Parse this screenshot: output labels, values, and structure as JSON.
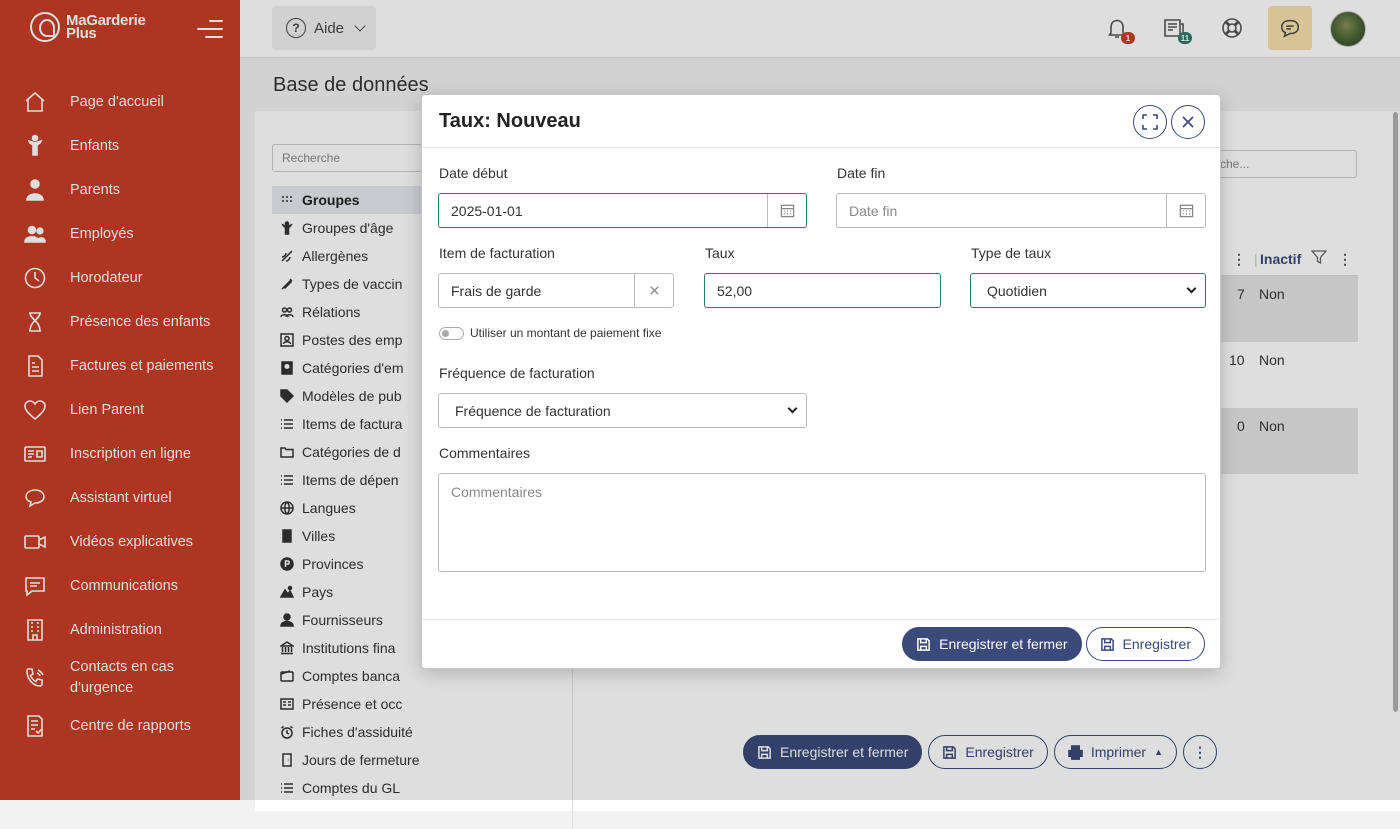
{
  "app": {
    "logo_line1": "MaGarderie",
    "logo_line2": "Plus"
  },
  "sidebar": {
    "items": [
      {
        "label": "Page d'accueil",
        "icon": "home-icon"
      },
      {
        "label": "Enfants",
        "icon": "child-icon"
      },
      {
        "label": "Parents",
        "icon": "parent-icon"
      },
      {
        "label": "Employés",
        "icon": "employees-icon"
      },
      {
        "label": "Horodateur",
        "icon": "clock-icon"
      },
      {
        "label": "Présence des enfants",
        "icon": "hourglass-icon"
      },
      {
        "label": "Factures et paiements",
        "icon": "invoice-icon"
      },
      {
        "label": "Lien Parent",
        "icon": "heart-icon"
      },
      {
        "label": "Inscription en ligne",
        "icon": "id-card-icon"
      },
      {
        "label": "Assistant virtuel",
        "icon": "chat-bubbles-icon"
      },
      {
        "label": "Vidéos explicatives",
        "icon": "video-icon"
      },
      {
        "label": "Communications",
        "icon": "message-icon"
      },
      {
        "label": "Administration",
        "icon": "building-icon"
      },
      {
        "label": "Contacts en cas d'urgence",
        "icon": "phone-icon"
      },
      {
        "label": "Centre de rapports",
        "icon": "report-icon"
      }
    ]
  },
  "topbar": {
    "help_label": "Aide",
    "notifications_badge": "1",
    "news_badge": "11",
    "colors": {
      "notif_badge": "#c93d29",
      "news_badge": "#2f7a6a"
    }
  },
  "page": {
    "title": "Base de données",
    "search_placeholder": "Recherche",
    "search_right_placeholder": "che...",
    "db_items": [
      "Groupes",
      "Groupes d'âge",
      "Allergènes",
      "Types de vaccin",
      "Rélations",
      "Postes des emp",
      "Catégories d'em",
      "Modèles de pub",
      "Items de factura",
      "Catégories de d",
      "Items de dépen",
      "Langues",
      "Villes",
      "Provinces",
      "Pays",
      "Fournisseurs",
      "Institutions fina",
      "Comptes banca",
      "Présence et occ",
      "Fiches d'assiduité",
      "Jours de fermeture",
      "Comptes du GL"
    ],
    "grid": {
      "header_inactive": "Inactif",
      "rows": [
        {
          "count": "7",
          "inactive": "Non"
        },
        {
          "count": "10",
          "inactive": "Non"
        },
        {
          "count": "0",
          "inactive": "Non"
        }
      ]
    },
    "footer": {
      "save_close": "Enregistrer et fermer",
      "save": "Enregistrer",
      "print": "Imprimer"
    }
  },
  "modal": {
    "title": "Taux: Nouveau",
    "date_debut_label": "Date début",
    "date_debut_value": "2025-01-01",
    "date_fin_label": "Date fin",
    "date_fin_placeholder": "Date fin",
    "item_label": "Item de facturation",
    "item_value": "Frais de garde",
    "taux_label": "Taux",
    "taux_value": "52,00",
    "type_label": "Type de taux",
    "type_value": "Quotidien",
    "toggle_label": "Utiliser un montant de paiement fixe",
    "frequence_label": "Fréquence de facturation",
    "frequence_value": "Fréquence de facturation",
    "commentaires_label": "Commentaires",
    "commentaires_placeholder": "Commentaires",
    "save_close": "Enregistrer et fermer",
    "save": "Enregistrer"
  },
  "colors": {
    "sidebar": "#c93d29",
    "primary": "#3a4a7a",
    "focus": "#2f7a6a",
    "chat_bg": "#f8e0ad"
  }
}
